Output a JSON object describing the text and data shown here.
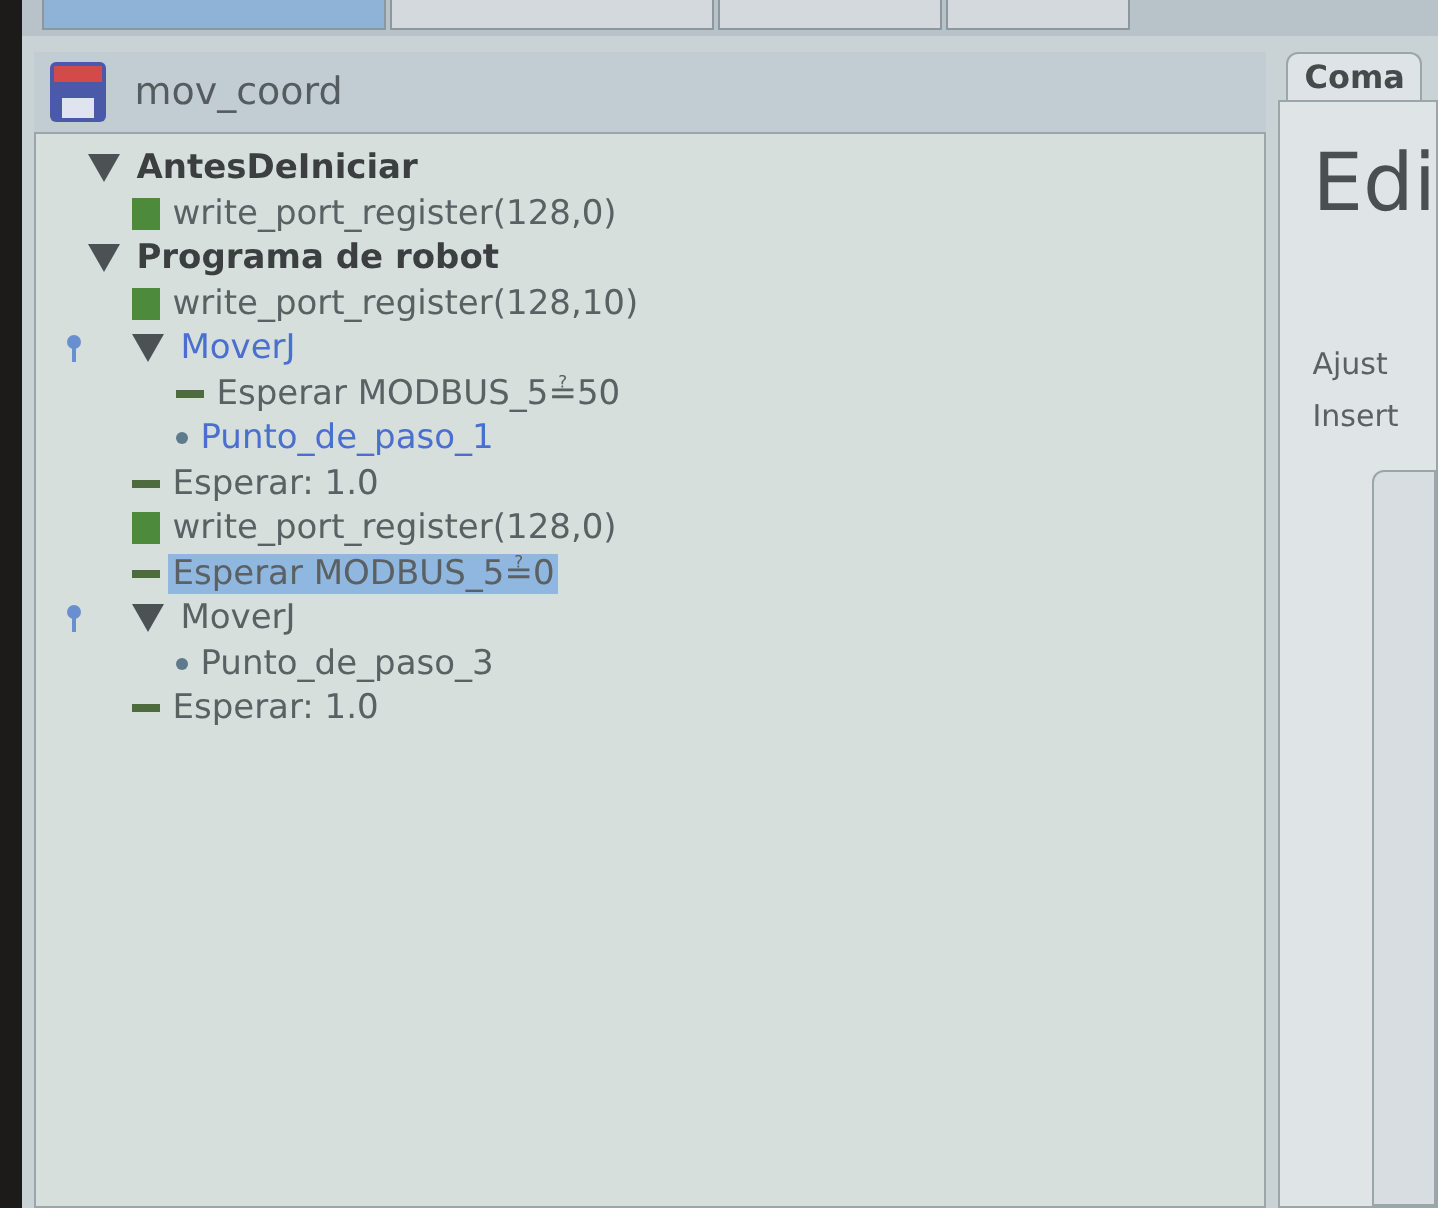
{
  "tabs": [
    {
      "selected": true
    },
    {
      "selected": false
    },
    {
      "selected": false
    },
    {
      "selected": false
    }
  ],
  "program": {
    "name": "mov_coord"
  },
  "tree": [
    {
      "kind": "section",
      "label": "AntesDeIniciar",
      "expanded": true,
      "active": false,
      "selected": false,
      "children": [
        {
          "kind": "script",
          "label": "write_port_register(128,0)",
          "active": false,
          "selected": false
        }
      ]
    },
    {
      "kind": "section",
      "label": "Programa de robot",
      "expanded": true,
      "active": false,
      "selected": false,
      "children": [
        {
          "kind": "script",
          "label": "write_port_register(128,10)",
          "active": false,
          "selected": false
        },
        {
          "kind": "move",
          "label": "MoverJ",
          "expanded": true,
          "active": true,
          "selected": false,
          "children": [
            {
              "kind": "wait",
              "label": "Esperar MODBUS_5≟50",
              "active": false,
              "selected": false
            },
            {
              "kind": "waypoint",
              "label": "Punto_de_paso_1",
              "active": true,
              "selected": false
            }
          ]
        },
        {
          "kind": "wait",
          "label": "Esperar: 1.0",
          "active": false,
          "selected": false
        },
        {
          "kind": "script",
          "label": "write_port_register(128,0)",
          "active": false,
          "selected": false
        },
        {
          "kind": "wait",
          "label": "Esperar MODBUS_5≟0",
          "active": false,
          "selected": true
        },
        {
          "kind": "move",
          "label": "MoverJ",
          "expanded": true,
          "active": false,
          "selected": false,
          "children": [
            {
              "kind": "waypoint",
              "label": "Punto_de_paso_3",
              "active": false,
              "selected": false
            }
          ]
        },
        {
          "kind": "wait",
          "label": "Esperar: 1.0",
          "active": false,
          "selected": false
        }
      ]
    }
  ],
  "side": {
    "tab": "Coma",
    "heading": "Edi",
    "lines": [
      "Ajust",
      "Insert"
    ]
  }
}
